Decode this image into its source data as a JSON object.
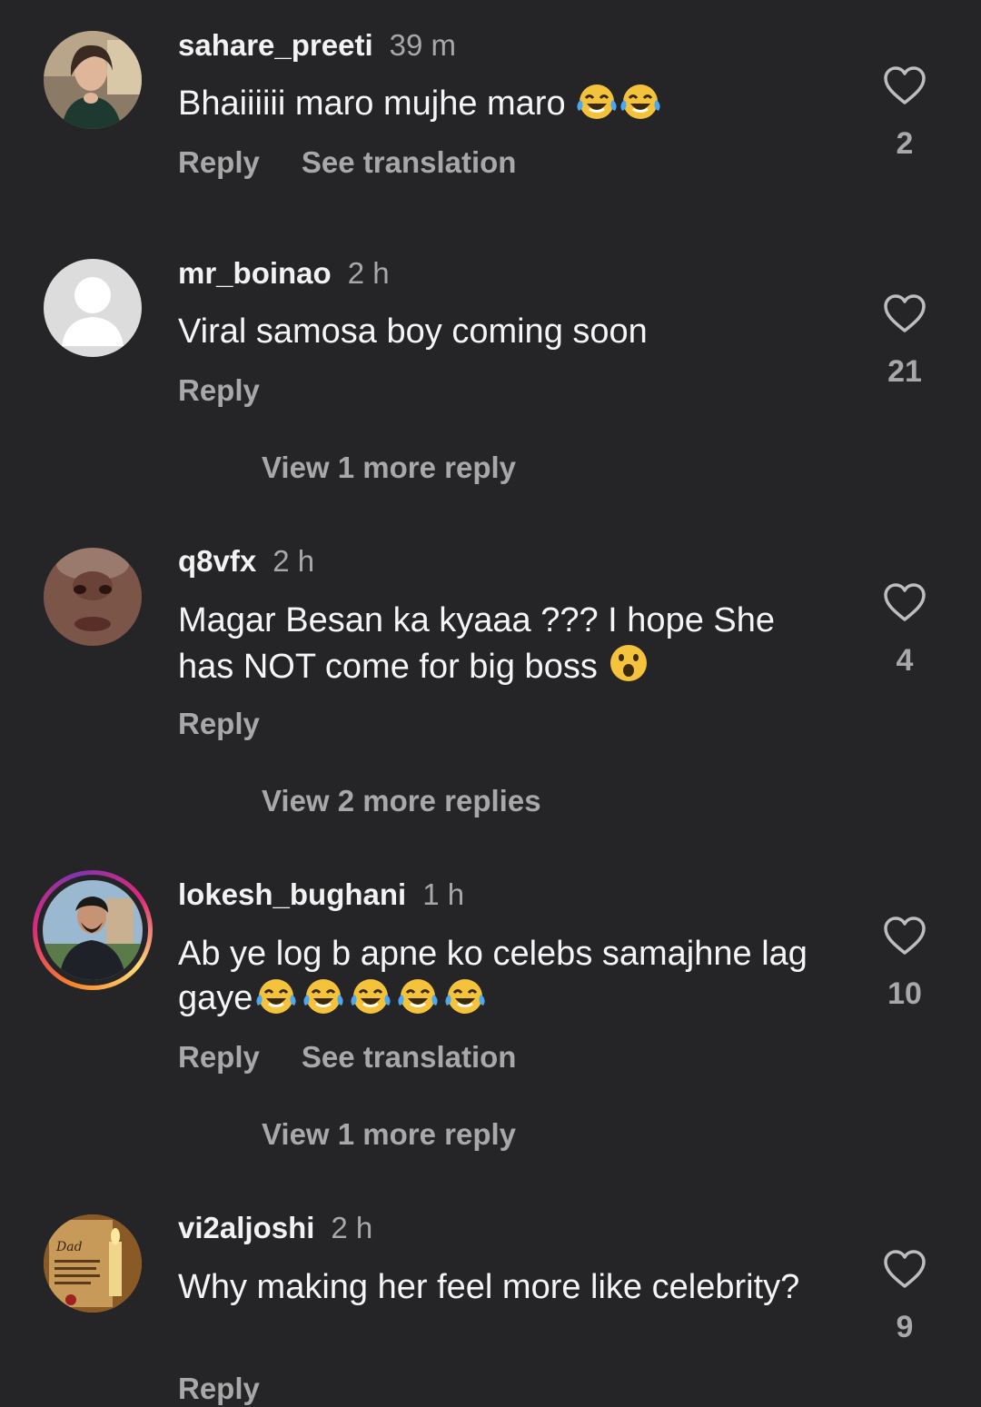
{
  "comments": [
    {
      "username": "sahare_preeti",
      "time": "39 m",
      "text": "Bhaiiiiii maro mujhe maro",
      "emoji": [
        "face-with-tears-of-joy",
        "face-with-tears-of-joy"
      ],
      "reply_label": "Reply",
      "translation_label": "See translation",
      "likes": "2"
    },
    {
      "username": "mr_boinao",
      "time": "2 h",
      "text": "Viral samosa boy coming soon",
      "reply_label": "Reply",
      "likes": "21",
      "view_replies": "View 1 more reply"
    },
    {
      "username": "q8vfx",
      "time": "2 h",
      "text": "Magar Besan ka kyaaa ??? I hope She has NOT come for big boss",
      "emoji": [
        "hushed-face"
      ],
      "reply_label": "Reply",
      "likes": "4",
      "view_replies": "View 2 more replies"
    },
    {
      "username": "lokesh_bughani",
      "time": "1 h",
      "text": "Ab ye log b apne ko celebs samajhne lag gaye",
      "emoji": [
        "face-with-tears-of-joy",
        "face-with-tears-of-joy",
        "face-with-tears-of-joy",
        "face-with-tears-of-joy",
        "face-with-tears-of-joy"
      ],
      "reply_label": "Reply",
      "translation_label": "See translation",
      "likes": "10",
      "view_replies": "View 1 more reply"
    },
    {
      "username": "vi2aljoshi",
      "time": "2 h",
      "text": "Why making her feel more like celebrity?",
      "reply_label": "Reply",
      "likes": "9",
      "avatar_text": "Dad"
    }
  ],
  "colors": {
    "background": "#252528",
    "primary_text": "#f5f5f5",
    "secondary_text": "#a8a8a8"
  }
}
